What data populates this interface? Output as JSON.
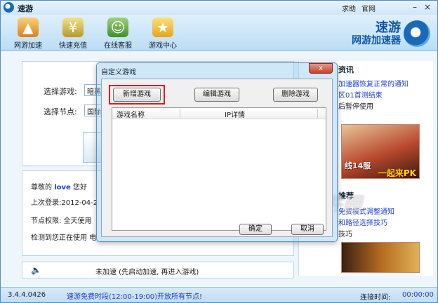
{
  "app": {
    "title": "速游",
    "top_links": [
      "求助",
      "官网"
    ],
    "controls": [
      "–",
      "×"
    ]
  },
  "toolbar": {
    "items": [
      {
        "label": "网游加速",
        "icon": "game-accelerate-icon"
      },
      {
        "label": "快速充值",
        "icon": "recharge-icon"
      },
      {
        "label": "在线客服",
        "icon": "support-icon"
      },
      {
        "label": "游戏中心",
        "icon": "game-center-icon"
      }
    ],
    "brand_line1": "速游",
    "brand_line2": "网游加速器"
  },
  "main": {
    "game_label": "选择游戏:",
    "game_value": "暗黑",
    "node_label": "选择节点:",
    "node_value": "国际"
  },
  "info": {
    "greeting_prefix": "尊敬的",
    "username": "love",
    "greeting_suffix": "您好",
    "last_login": "上次登录:2012-04-2",
    "node_permission": "节点权限: 全天使用",
    "detect": "检测到您正在使用 电"
  },
  "status": {
    "text": "未加速 (先启动加速, 再进入游戏)"
  },
  "news": {
    "heading1": "资讯",
    "items1": [
      {
        "text": "加速器恢复正常的通知",
        "link": true
      },
      {
        "text": "区01首测结束",
        "link": true
      },
      {
        "text": "后暂停使用",
        "link": false
      }
    ],
    "ad1_text1": "线14服",
    "ad1_text2": "一起来PK",
    "heading2": "推荐",
    "items2": [
      {
        "text": "免费模式调整通知",
        "link": true
      },
      {
        "text": "和路径选择技巧",
        "link": true
      },
      {
        "text": "技巧",
        "link": false
      }
    ]
  },
  "footer": {
    "version": "3.4.4.0426",
    "promo": "速游免费时段(12:00-19:00)开放所有节点!",
    "conn_label": "连接时间:",
    "conn_time": "00:00:00"
  },
  "watermark": "西西软件园",
  "dialog": {
    "title": "自定义游戏",
    "close": "x",
    "buttons": {
      "add": "新增游戏",
      "edit": "编辑游戏",
      "delete": "删除游戏",
      "ok": "确定",
      "cancel": "取消"
    },
    "columns": [
      "游戏名称",
      "IP详情"
    ]
  },
  "colors": {
    "accent": "#1a68b8",
    "link": "#1a3fd0",
    "highlight_frame": "#e11a1a"
  }
}
